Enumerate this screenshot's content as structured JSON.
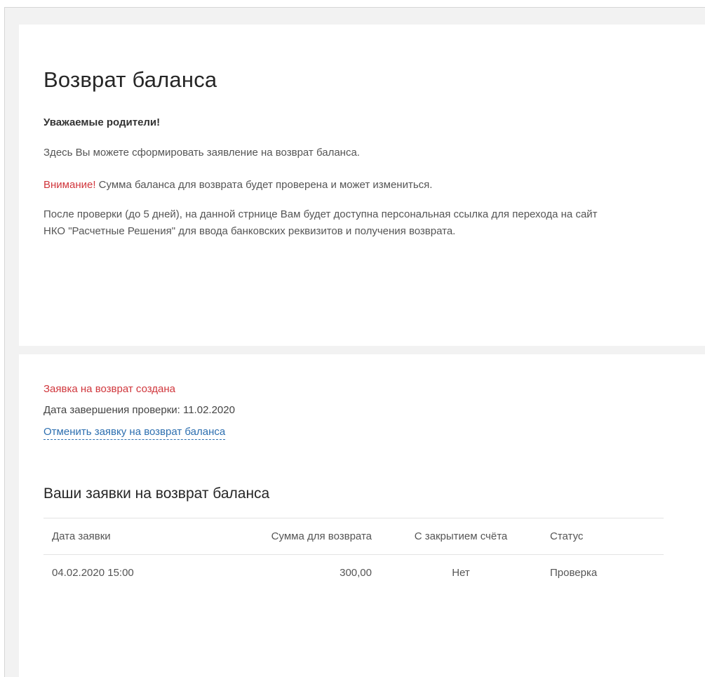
{
  "page": {
    "title": "Возврат баланса",
    "greeting": "Уважаемые родители!",
    "intro": "Здесь Вы можете сформировать заявление на возврат баланса.",
    "attention_label": "Внимание!",
    "attention_text": " Сумма баланса для возврата будет проверена и может измениться.",
    "after_check": "После проверки (до 5 дней), на данной стрнице Вам будет доступна персональная ссылка для перехода на сайт НКО \"Расчетные Решения\" для ввода банковских реквизитов и получения возврата."
  },
  "request_status": {
    "created": "Заявка на возврат создана",
    "check_date": "Дата завершения проверки: 11.02.2020",
    "cancel_link": "Отменить заявку на возврат баланса"
  },
  "requests": {
    "title": "Ваши заявки на возврат баланса",
    "columns": [
      "Дата заявки",
      "Сумма для возврата",
      "С закрытием счёта",
      "Статус"
    ],
    "rows": [
      {
        "date": "04.02.2020 15:00",
        "amount": "300,00",
        "close_account": "Нет",
        "status": "Проверка"
      }
    ]
  },
  "colors": {
    "accent_red": "#d0363c",
    "link_blue": "#2d6fb0",
    "background": "#f2f2f2"
  }
}
